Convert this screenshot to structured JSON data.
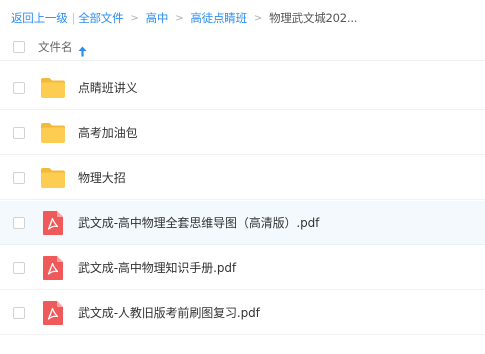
{
  "breadcrumb": {
    "back_label": "返回上一级",
    "separator": "|",
    "arrow": ">",
    "items": [
      "全部文件",
      "高中",
      "高徒点睛班"
    ],
    "current": "物理武文城202..."
  },
  "header": {
    "name_column_label": "文件名",
    "sort_direction": "ascending",
    "sort_icon": "arrow-up-icon"
  },
  "files": [
    {
      "name": "点睛班讲义",
      "type": "folder",
      "icon": "folder-icon"
    },
    {
      "name": "高考加油包",
      "type": "folder",
      "icon": "folder-icon"
    },
    {
      "name": "物理大招",
      "type": "folder",
      "icon": "folder-icon"
    },
    {
      "name": "武文成-高中物理全套思维导图（高清版）.pdf",
      "type": "pdf",
      "icon": "pdf-icon",
      "hovered": true
    },
    {
      "name": "武文成-高中物理知识手册.pdf",
      "type": "pdf",
      "icon": "pdf-icon"
    },
    {
      "name": "武文成-人教旧版考前刷图复习.pdf",
      "type": "pdf",
      "icon": "pdf-icon"
    }
  ],
  "colors": {
    "link": "#2b8ef0",
    "folder": "#fdcd52",
    "pdf": "#f0595a",
    "row_hover": "#f3f9fd"
  }
}
